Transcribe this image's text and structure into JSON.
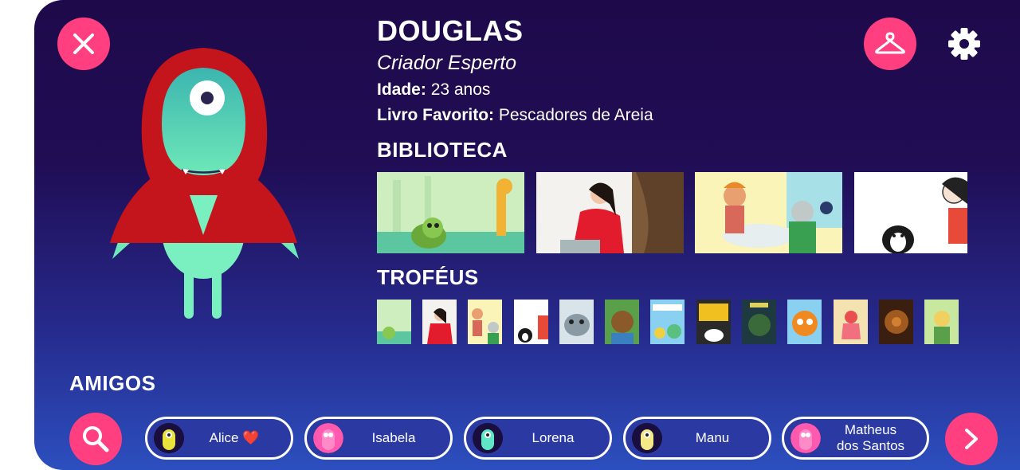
{
  "profile": {
    "name": "DOUGLAS",
    "title": "Criador Esperto",
    "age_label": "Idade:",
    "age_value": "23 anos",
    "book_label": "Livro Favorito:",
    "book_value": "Pescadores de Areia"
  },
  "sections": {
    "library": "BIBLIOTECA",
    "trophies": "TROFÉUS",
    "friends": "AMIGOS"
  },
  "friends": [
    {
      "name": "Alice",
      "heart": "❤️",
      "avatar_color": "#e8e23a"
    },
    {
      "name": "Isabela",
      "avatar_color": "#ff59b0"
    },
    {
      "name": "Lorena",
      "avatar_color": "#5fe6c6"
    },
    {
      "name": "Manu",
      "avatar_color": "#f5e886"
    },
    {
      "name": "Matheus",
      "name2": "dos Santos",
      "avatar_color": "#ff59b0"
    }
  ],
  "colors": {
    "accent": "#ff3f7f",
    "background_top": "#1e0a4a",
    "background_bottom": "#2c4fbf"
  },
  "icons": {
    "close": "close-icon",
    "wardrobe": "hanger-icon",
    "settings": "gear-icon",
    "search": "search-icon",
    "next": "chevron-right-icon"
  }
}
